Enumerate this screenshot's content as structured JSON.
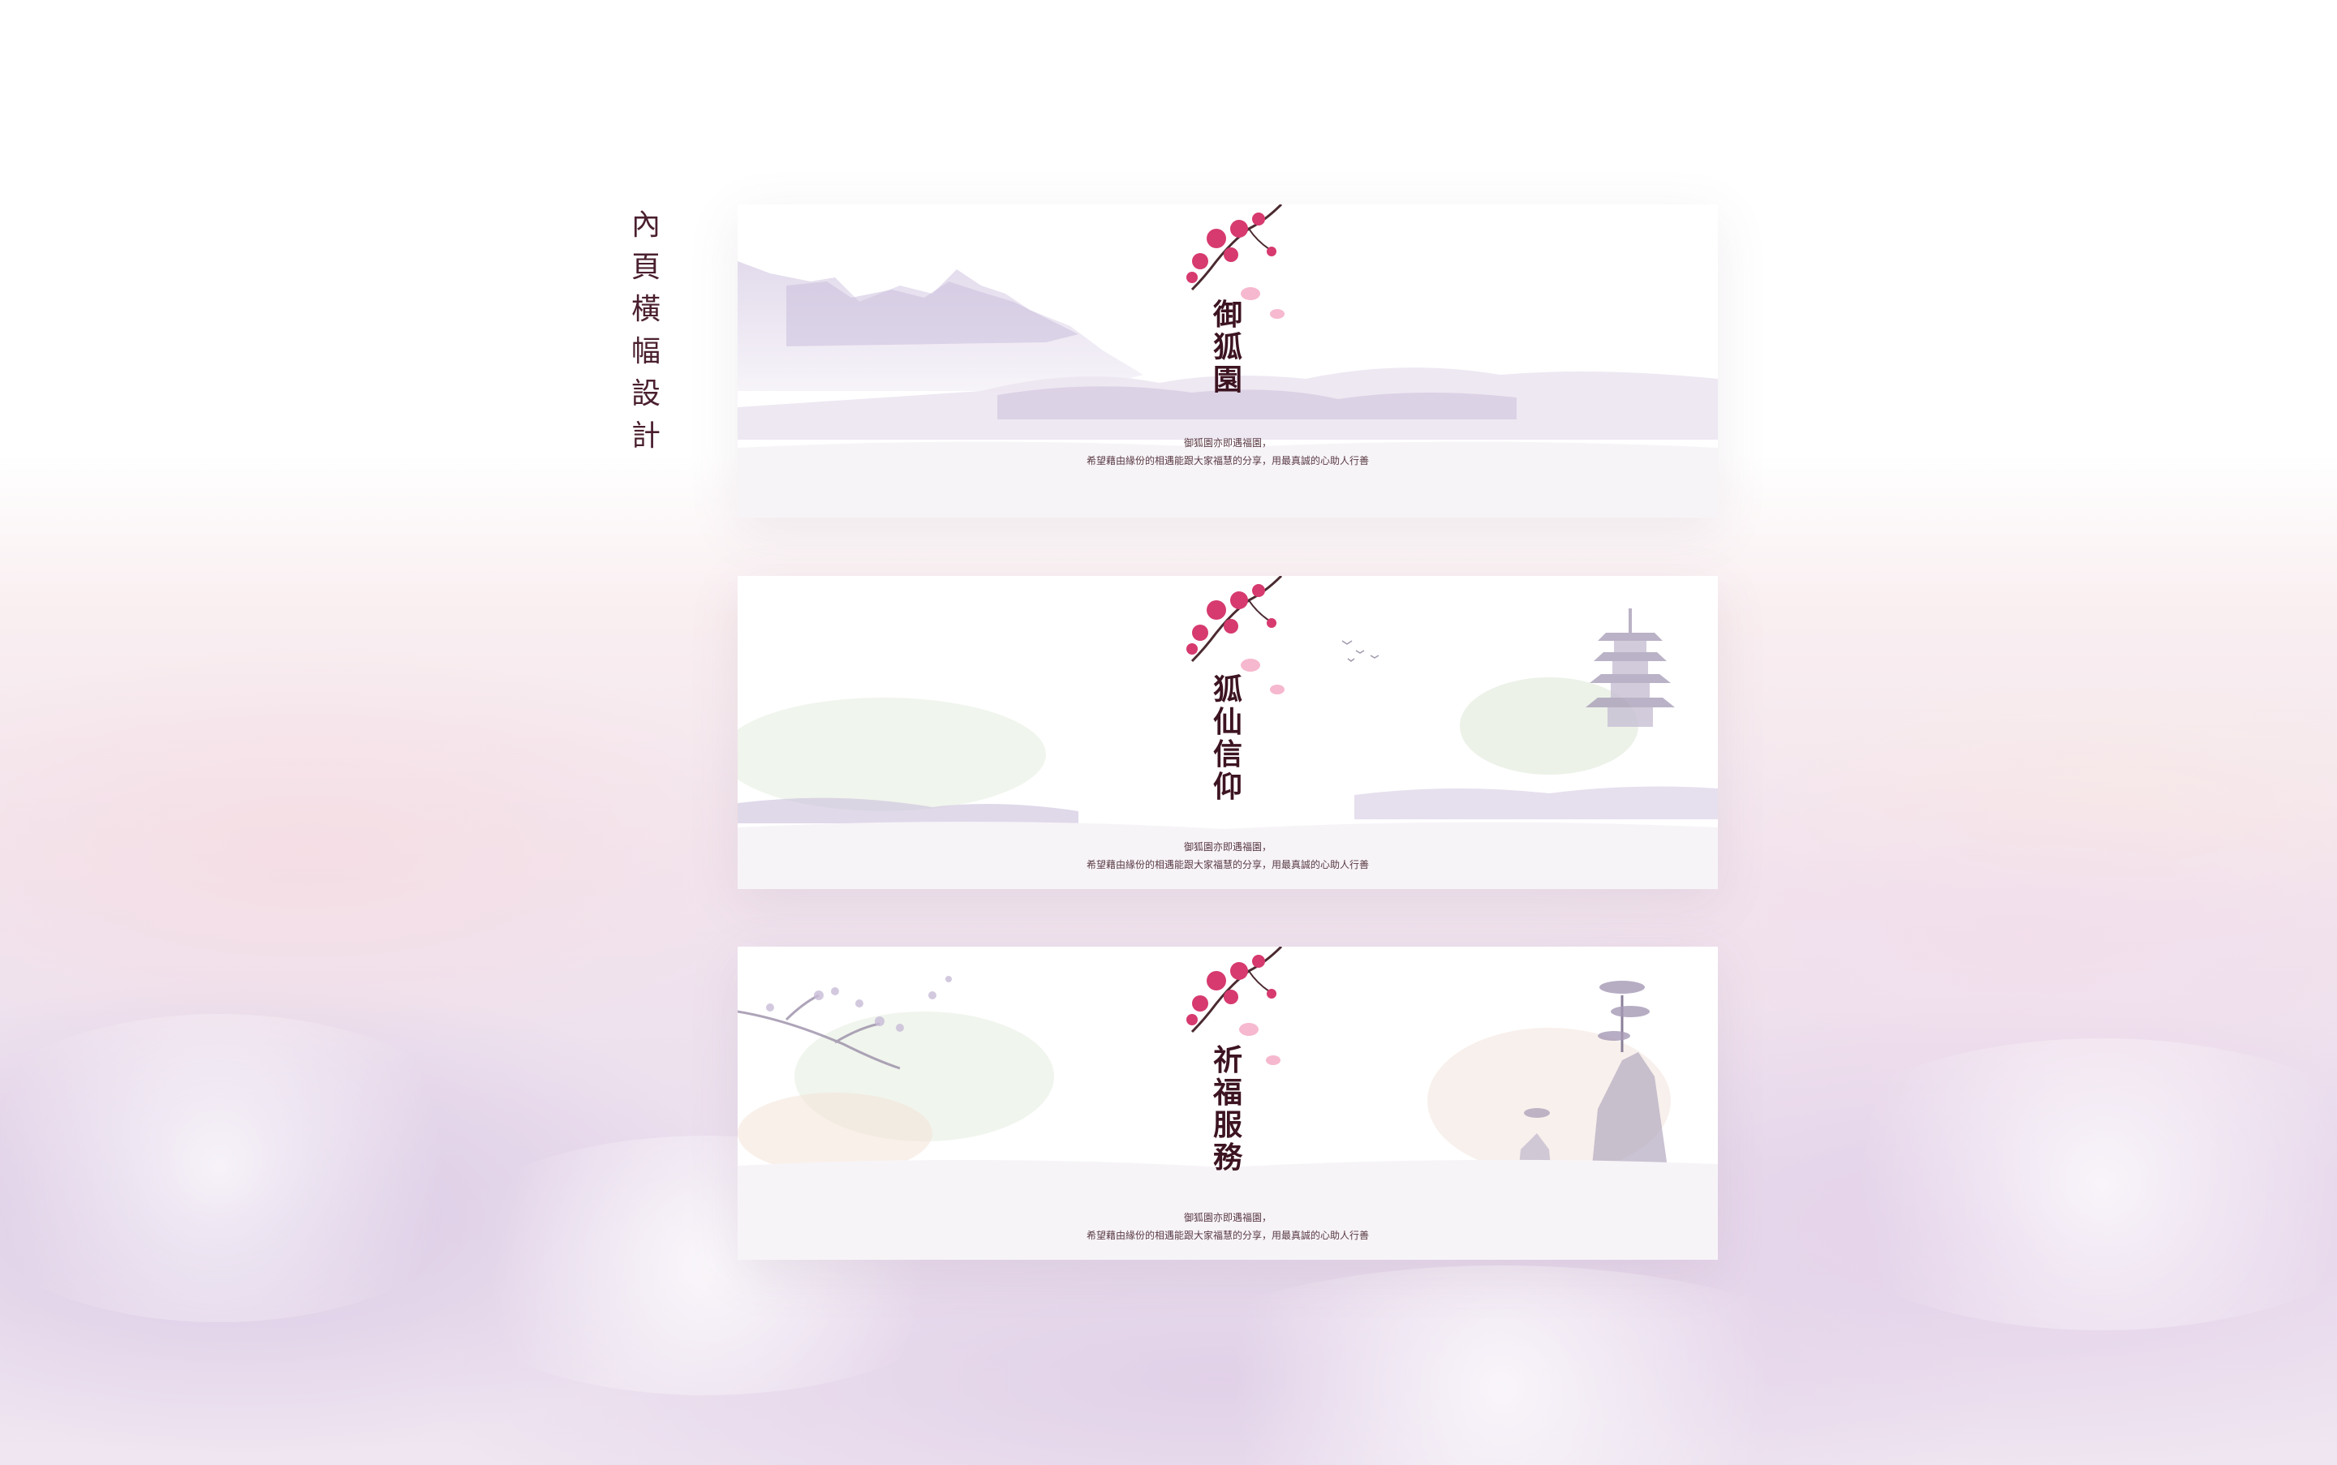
{
  "page": {
    "side_title": [
      "內",
      "頁",
      "橫",
      "幅",
      "設",
      "計"
    ]
  },
  "banners": [
    {
      "title": [
        "御",
        "狐",
        "園"
      ],
      "desc_line1": "御狐園亦即遇福園，",
      "desc_line2": "希望藉由緣份的相遇能跟大家福慧的分享，用最真誠的心助人行善",
      "scene": "mountain-landscape"
    },
    {
      "title": [
        "狐",
        "仙",
        "信",
        "仰"
      ],
      "desc_line1": "御狐園亦即遇福園，",
      "desc_line2": "希望藉由緣份的相遇能跟大家福慧的分享，用最真誠的心助人行善",
      "scene": "pagoda-landscape"
    },
    {
      "title": [
        "祈",
        "福",
        "服",
        "務"
      ],
      "desc_line1": "御狐園亦即遇福園，",
      "desc_line2": "希望藉由緣份的相遇能跟大家福慧的分享，用最真誠的心助人行善",
      "scene": "pine-cliff-landscape"
    }
  ],
  "colors": {
    "title_text": "#3d1421",
    "side_title_text": "#4a1f2f",
    "blossom_pink": "#d63a6e",
    "branch_dark": "#4a2a30",
    "ink_lavender": "#c8bcd8"
  },
  "icons": [
    "cherry-blossom-branch-icon",
    "mountain-ink-illustration",
    "pagoda-ink-illustration",
    "pine-cliff-ink-illustration"
  ]
}
